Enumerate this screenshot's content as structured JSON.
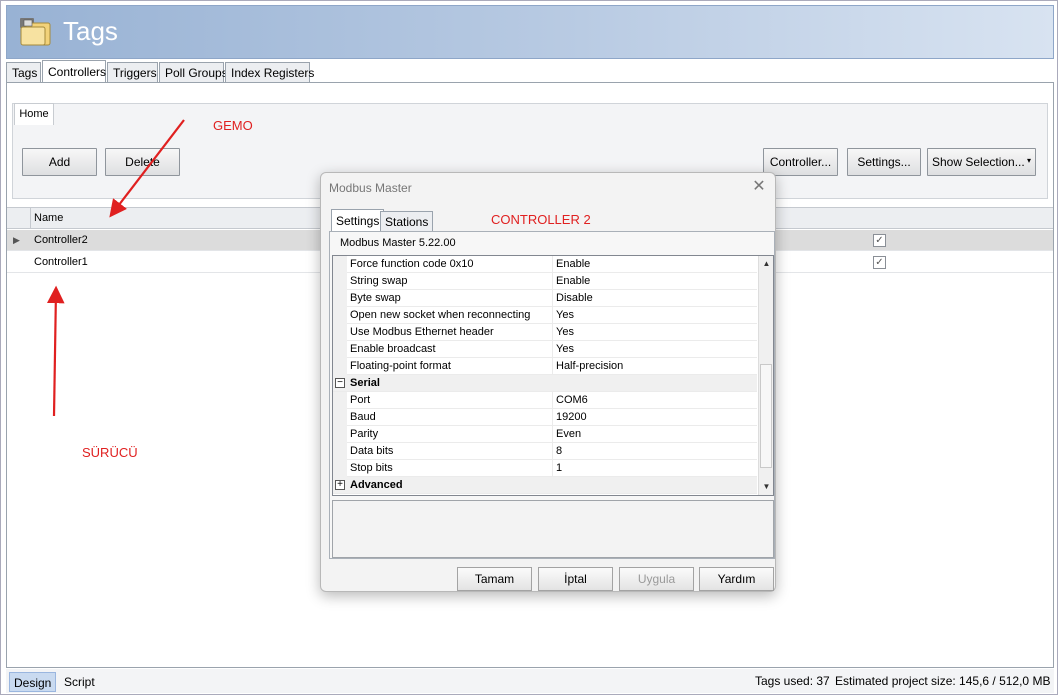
{
  "window": {
    "title": "Tags",
    "icon": "folder-tags-icon"
  },
  "main_tabs": [
    {
      "label": "Tags",
      "active": false
    },
    {
      "label": "Controllers",
      "active": true
    },
    {
      "label": "Triggers",
      "active": false
    },
    {
      "label": "Poll Groups",
      "active": false
    },
    {
      "label": "Index Registers",
      "active": false
    }
  ],
  "ribbon": {
    "tab": "Home",
    "add_label": "Add",
    "delete_label": "Delete",
    "controller_label": "Controller...",
    "settings_label": "Settings...",
    "show_selection_label": "Show Selection..."
  },
  "grid": {
    "column_name": "Name",
    "rows": [
      {
        "name": "Controller2",
        "checked": true,
        "selected": true
      },
      {
        "name": "Controller1",
        "checked": true,
        "selected": false
      }
    ]
  },
  "annotations": {
    "gemo": "GEMO",
    "controller2": "CONTROLLER 2",
    "surucu": "SÜRÜCÜ",
    "color": "#e02020"
  },
  "dialog": {
    "title": "Modbus Master",
    "tabs": [
      "Settings",
      "Stations"
    ],
    "version": "Modbus Master 5.22.00",
    "properties": [
      {
        "name": "Force function code 0x10",
        "value": "Enable"
      },
      {
        "name": "String swap",
        "value": "Enable"
      },
      {
        "name": "Byte swap",
        "value": "Disable"
      },
      {
        "name": "Open new socket when reconnecting",
        "value": "Yes"
      },
      {
        "name": "Use Modbus Ethernet header",
        "value": "Yes"
      },
      {
        "name": "Enable broadcast",
        "value": "Yes"
      },
      {
        "name": "Floating-point format",
        "value": "Half-precision"
      }
    ],
    "serial_category": "Serial",
    "serial": [
      {
        "name": "Port",
        "value": "COM6"
      },
      {
        "name": "Baud",
        "value": "19200"
      },
      {
        "name": "Parity",
        "value": "Even"
      },
      {
        "name": "Data bits",
        "value": "8"
      },
      {
        "name": "Stop bits",
        "value": "1"
      }
    ],
    "advanced_category": "Advanced",
    "buttons": {
      "ok": "Tamam",
      "cancel": "İptal",
      "apply": "Uygula",
      "help": "Yardım"
    }
  },
  "statusbar": {
    "design": "Design",
    "script": "Script",
    "tags_used": "Tags used: 37",
    "project_size": "Estimated project size: 145,6 / 512,0 MB"
  },
  "colors": {
    "header_accent": "#98b2d4",
    "selected_row": "#dcdcdc"
  }
}
